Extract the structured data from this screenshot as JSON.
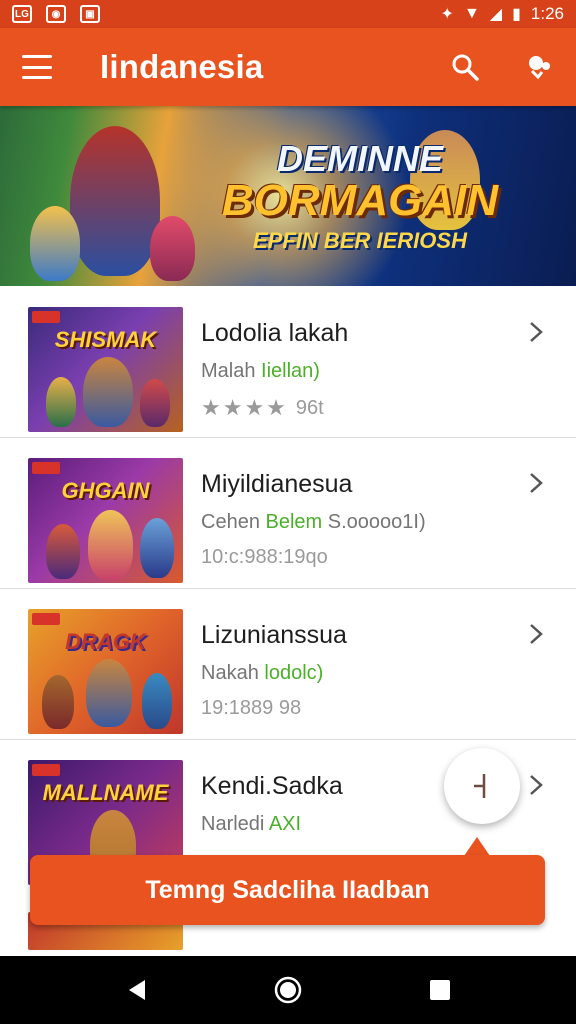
{
  "status_bar": {
    "time": "1:26",
    "icons": [
      "notification-icon",
      "media-icon",
      "app-icon",
      "settings-icon",
      "wifi-icon",
      "signal-icon",
      "battery-icon"
    ]
  },
  "app_bar": {
    "title": "Iindanesia",
    "icons": [
      "menu-icon",
      "search-icon",
      "more-icon"
    ]
  },
  "banner": {
    "line1": "DEMINNE",
    "line2": "BORMAGAIN",
    "line3": "EPFIN BER IERIOSH"
  },
  "list": {
    "items": [
      {
        "title": "Lodolia lakah",
        "subtitle_prefix": "Malah ",
        "subtitle_accent": "Iiellan)",
        "meta": "96t",
        "rating": 4,
        "thumb_title": "SHISMAK",
        "thumb_colors": [
          "#3a2a7a",
          "#b7621f"
        ]
      },
      {
        "title": "Miyildianesua",
        "subtitle_prefix": "Cehen ",
        "subtitle_accent": "Belem",
        "subtitle_suffix": " S.ooooo1I)",
        "meta": "10:c:988:19qo",
        "thumb_title": "GHGAIN",
        "thumb_colors": [
          "#5a1d7a",
          "#d85b2a"
        ]
      },
      {
        "title": "Lizunianssua",
        "subtitle_prefix": "Nakah ",
        "subtitle_accent": "lodolc)",
        "meta": "19:1889 98",
        "thumb_title": "DRAGK",
        "thumb_colors": [
          "#e8a12a",
          "#c0362b"
        ]
      },
      {
        "title": "Kendi.Sadka",
        "subtitle_prefix": "Narledi ",
        "subtitle_accent": "AXI",
        "meta": "",
        "thumb_title": "MALLNAME",
        "thumb_colors": [
          "#3b1a6a",
          "#c23b5c"
        ]
      }
    ]
  },
  "cta": {
    "label": "Temng Sadcliha IIadban"
  },
  "fab": {
    "icon": "add-icon"
  },
  "nav_bar": {
    "icons": [
      "back-icon",
      "home-icon",
      "recents-icon"
    ]
  },
  "colors": {
    "primary": "#e8531f",
    "status": "#d8421a",
    "accent_text": "#4caf2a"
  }
}
